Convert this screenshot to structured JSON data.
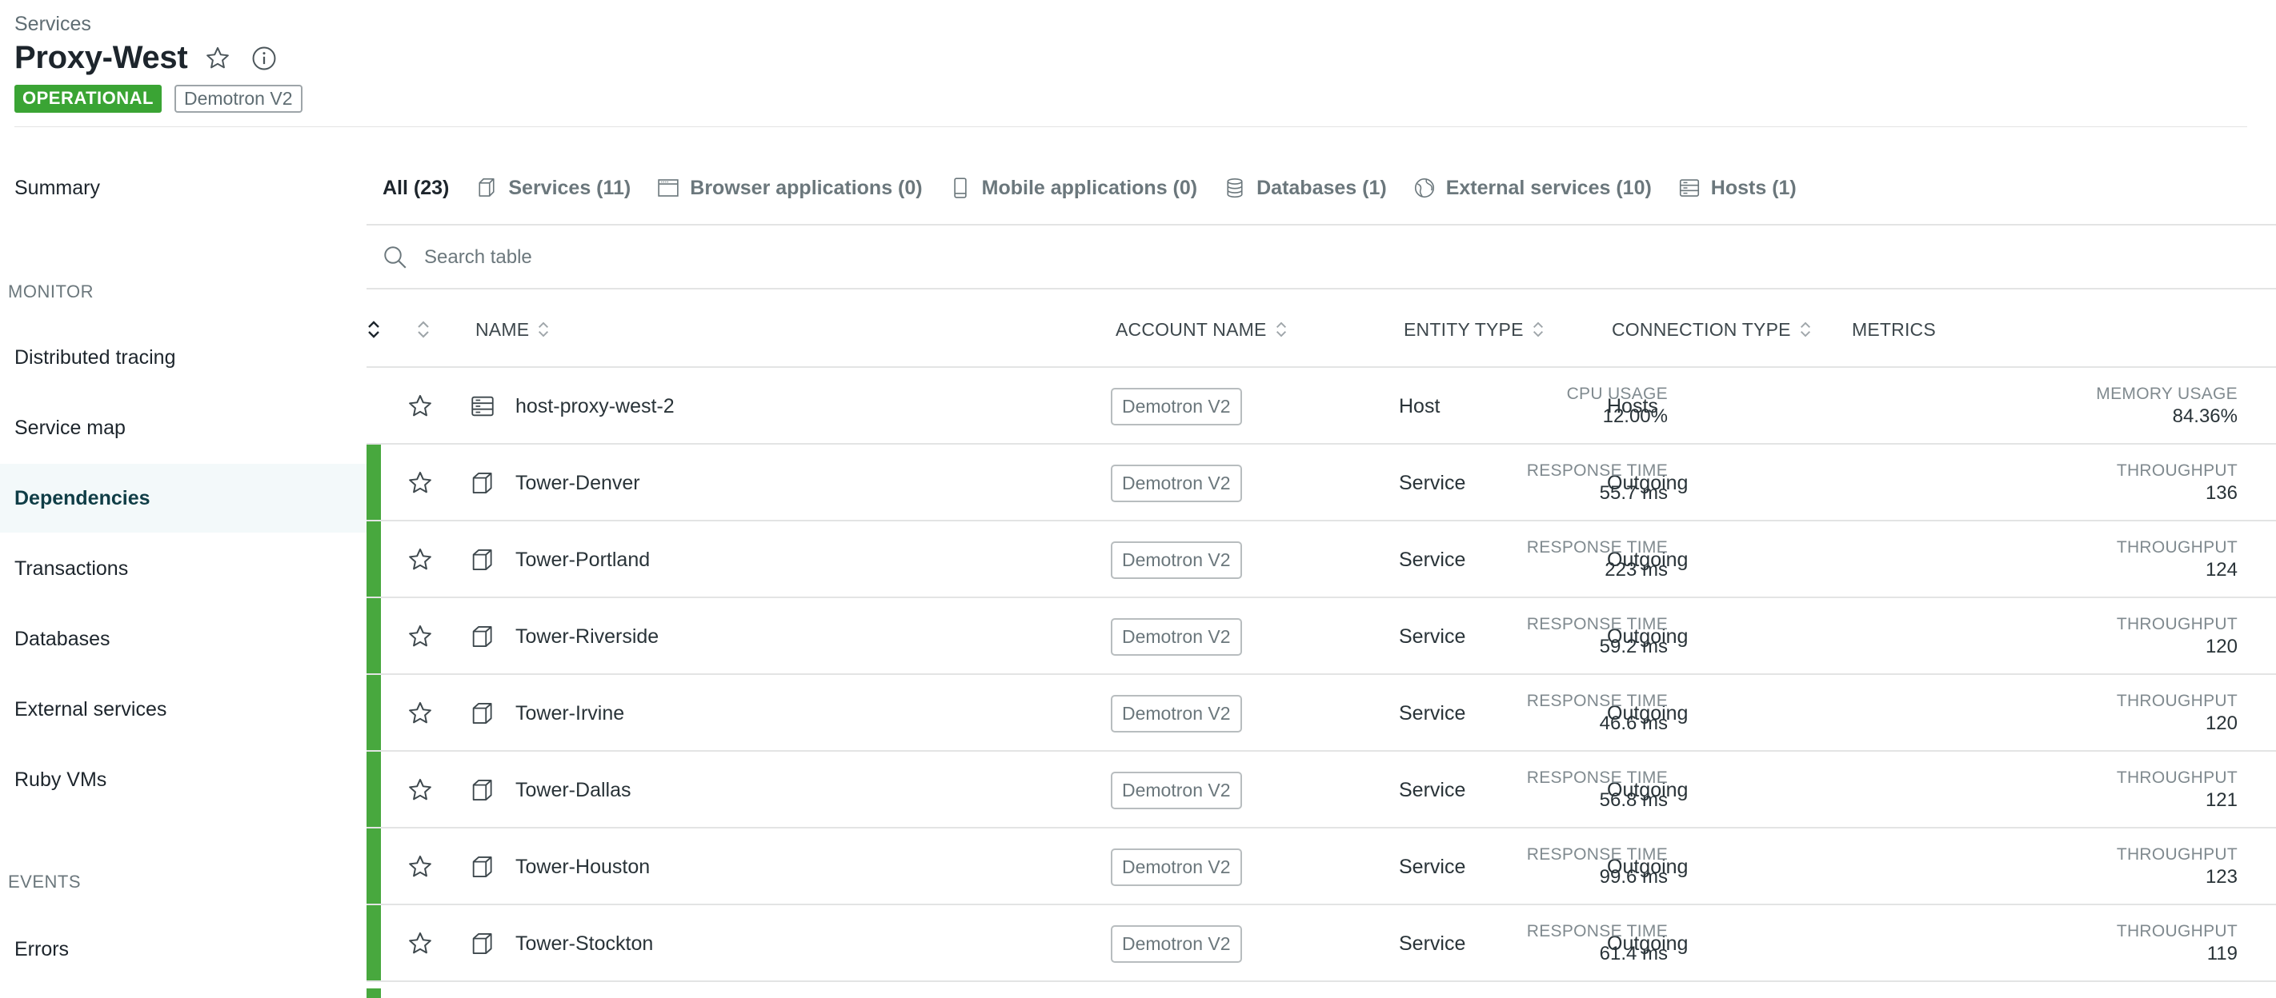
{
  "header": {
    "breadcrumb": "Services",
    "title": "Proxy-West",
    "status_badge": "OPERATIONAL",
    "account_badge": "Demotron V2"
  },
  "sidebar": {
    "summary": "Summary",
    "monitor_heading": "MONITOR",
    "monitor_items": [
      "Distributed tracing",
      "Service map",
      "Dependencies",
      "Transactions",
      "Databases",
      "External services",
      "Ruby VMs"
    ],
    "active_item": "Dependencies",
    "events_heading": "EVENTS",
    "events_items": [
      "Errors"
    ]
  },
  "tabs": [
    {
      "label": "All (23)",
      "icon": "none"
    },
    {
      "label": "Services (11)",
      "icon": "cube-icon"
    },
    {
      "label": "Browser applications (0)",
      "icon": "browser-window-icon"
    },
    {
      "label": "Mobile applications (0)",
      "icon": "mobile-phone-icon"
    },
    {
      "label": "Databases (1)",
      "icon": "database-icon"
    },
    {
      "label": "External services (10)",
      "icon": "globe-icon"
    },
    {
      "label": "Hosts (1)",
      "icon": "server-icon"
    }
  ],
  "search": {
    "placeholder": "Search table"
  },
  "table": {
    "headers": {
      "name": "NAME",
      "account_name": "ACCOUNT NAME",
      "entity_type": "ENTITY TYPE",
      "connection_type": "CONNECTION TYPE",
      "metrics": "METRICS"
    },
    "status_color": "#48a83e",
    "rows": [
      {
        "name": "host-proxy-west-2",
        "icon": "server-icon",
        "account": "Demotron V2",
        "entity_type": "Host",
        "connection_type": "Hosts",
        "status": "none",
        "metric1_label": "CPU USAGE",
        "metric1_value": "12.00%",
        "metric2_label": "MEMORY USAGE",
        "metric2_value": "84.36%"
      },
      {
        "name": "Tower-Denver",
        "icon": "cube-icon",
        "account": "Demotron V2",
        "entity_type": "Service",
        "connection_type": "Outgoing",
        "status": "operational",
        "metric1_label": "RESPONSE TIME",
        "metric1_value": "55.7 ms",
        "metric2_label": "THROUGHPUT",
        "metric2_value": "136"
      },
      {
        "name": "Tower-Portland",
        "icon": "cube-icon",
        "account": "Demotron V2",
        "entity_type": "Service",
        "connection_type": "Outgoing",
        "status": "operational",
        "metric1_label": "RESPONSE TIME",
        "metric1_value": "223 ms",
        "metric2_label": "THROUGHPUT",
        "metric2_value": "124"
      },
      {
        "name": "Tower-Riverside",
        "icon": "cube-icon",
        "account": "Demotron V2",
        "entity_type": "Service",
        "connection_type": "Outgoing",
        "status": "operational",
        "metric1_label": "RESPONSE TIME",
        "metric1_value": "59.2 ms",
        "metric2_label": "THROUGHPUT",
        "metric2_value": "120"
      },
      {
        "name": "Tower-Irvine",
        "icon": "cube-icon",
        "account": "Demotron V2",
        "entity_type": "Service",
        "connection_type": "Outgoing",
        "status": "operational",
        "metric1_label": "RESPONSE TIME",
        "metric1_value": "46.6 ms",
        "metric2_label": "THROUGHPUT",
        "metric2_value": "120"
      },
      {
        "name": "Tower-Dallas",
        "icon": "cube-icon",
        "account": "Demotron V2",
        "entity_type": "Service",
        "connection_type": "Outgoing",
        "status": "operational",
        "metric1_label": "RESPONSE TIME",
        "metric1_value": "56.8 ms",
        "metric2_label": "THROUGHPUT",
        "metric2_value": "121"
      },
      {
        "name": "Tower-Houston",
        "icon": "cube-icon",
        "account": "Demotron V2",
        "entity_type": "Service",
        "connection_type": "Outgoing",
        "status": "operational",
        "metric1_label": "RESPONSE TIME",
        "metric1_value": "99.6 ms",
        "metric2_label": "THROUGHPUT",
        "metric2_value": "123"
      },
      {
        "name": "Tower-Stockton",
        "icon": "cube-icon",
        "account": "Demotron V2",
        "entity_type": "Service",
        "connection_type": "Outgoing",
        "status": "operational",
        "metric1_label": "RESPONSE TIME",
        "metric1_value": "61.4 ms",
        "metric2_label": "THROUGHPUT",
        "metric2_value": "119"
      }
    ]
  }
}
